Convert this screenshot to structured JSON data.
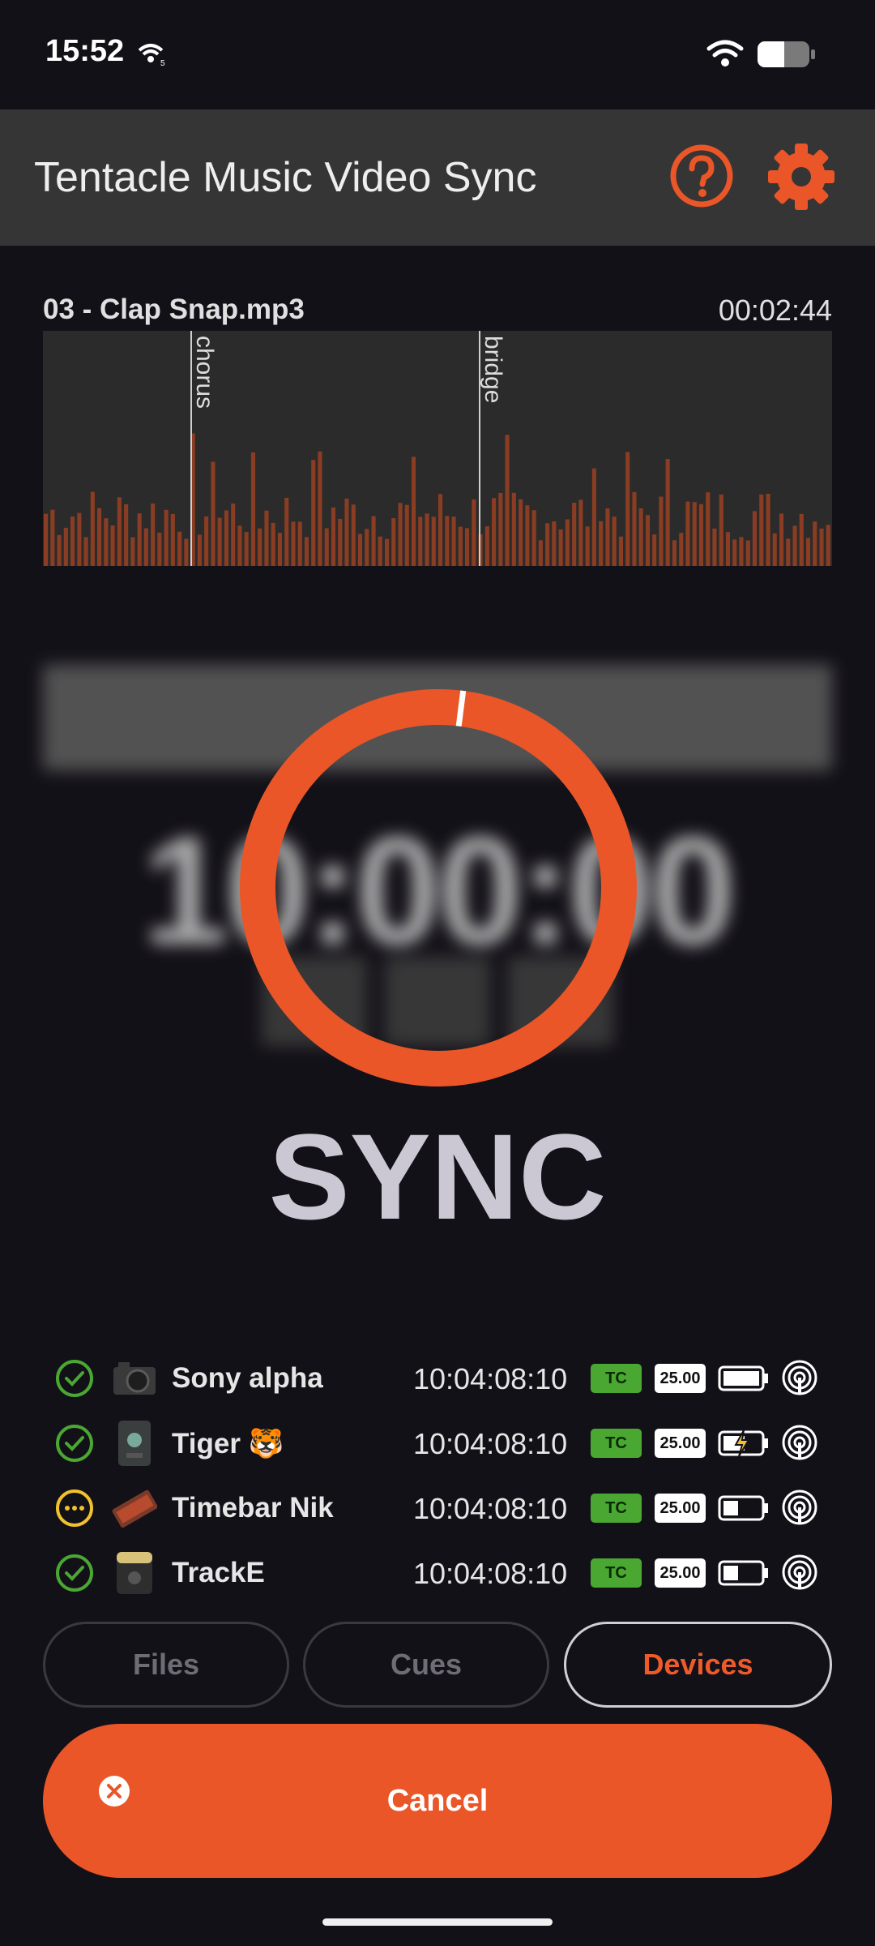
{
  "status_bar": {
    "time": "15:52",
    "icons": [
      "wifi-5-icon",
      "wifi-icon",
      "battery-icon"
    ]
  },
  "header": {
    "title": "Tentacle Music Video Sync",
    "help_icon": "help-circle-icon",
    "settings_icon": "gear-icon",
    "accent": "#ea5628"
  },
  "song": {
    "name": "03 - Clap Snap.mp3",
    "duration": "00:02:44",
    "markers": [
      "chorus",
      "bridge"
    ]
  },
  "timecode": {
    "value": "10:00:00"
  },
  "sync": {
    "label": "SYNC",
    "progress": 0.02
  },
  "devices": [
    {
      "status": "synced",
      "thumb": "camera-icon",
      "name": "Sony alpha",
      "timecode": "10:04:08:10",
      "tc": "TC",
      "fps": "25.00",
      "battery": 1.0,
      "charging": false
    },
    {
      "status": "synced",
      "thumb": "tentacle-device-icon",
      "name": "Tiger 🐯",
      "timecode": "10:04:08:10",
      "tc": "TC",
      "fps": "25.00",
      "battery": 0.6,
      "charging": true
    },
    {
      "status": "pending",
      "thumb": "timebar-icon",
      "name": "Timebar Nik",
      "timecode": "10:04:08:10",
      "tc": "TC",
      "fps": "25.00",
      "battery": 0.4,
      "charging": false
    },
    {
      "status": "synced",
      "thumb": "track-e-icon",
      "name": "TrackE",
      "timecode": "10:04:08:10",
      "tc": "TC",
      "fps": "25.00",
      "battery": 0.4,
      "charging": false
    }
  ],
  "tabs": [
    {
      "label": "Files",
      "active": false
    },
    {
      "label": "Cues",
      "active": false
    },
    {
      "label": "Devices",
      "active": true
    }
  ],
  "cancel": {
    "label": "Cancel",
    "icon": "close-circle-icon"
  }
}
